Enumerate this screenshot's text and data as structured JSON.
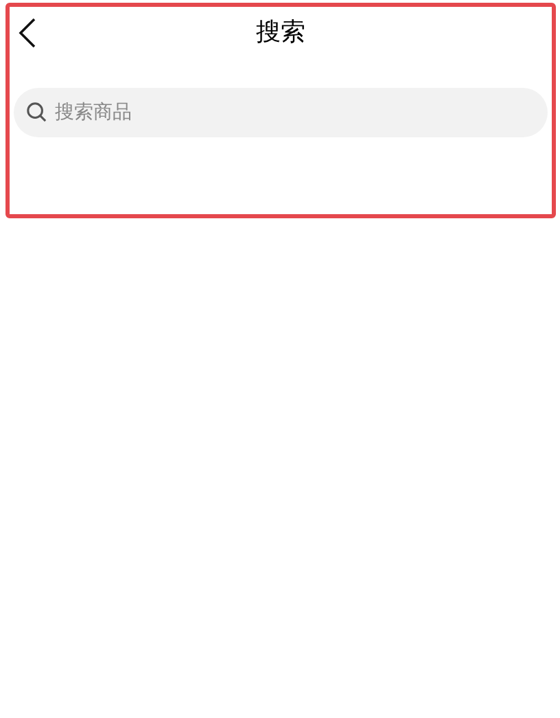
{
  "header": {
    "title": "搜索"
  },
  "search": {
    "placeholder": "搜索商品"
  }
}
